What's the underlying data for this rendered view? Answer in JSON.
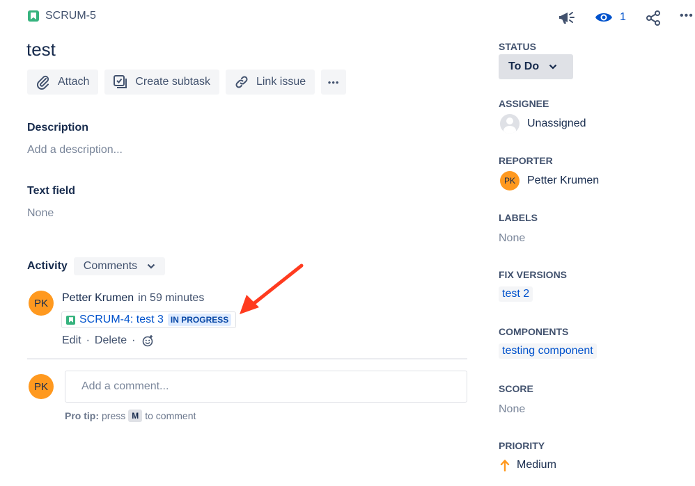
{
  "issue": {
    "key": "SCRUM-5",
    "title": "test"
  },
  "toolbar": {
    "attach_label": "Attach",
    "create_subtask_label": "Create subtask",
    "link_issue_label": "Link issue",
    "more_label": "•••"
  },
  "header_actions": {
    "watchers_count": "1",
    "more_label": "•••"
  },
  "description": {
    "heading": "Description",
    "placeholder": "Add a description..."
  },
  "text_field": {
    "heading": "Text field",
    "value": "None"
  },
  "activity": {
    "heading": "Activity",
    "filter_value": "Comments",
    "comment": {
      "author_initials": "PK",
      "author": "Petter Krumen",
      "time": "in 59 minutes",
      "linked_issue": "SCRUM-4: test 3",
      "linked_status": "IN PROGRESS",
      "edit_label": "Edit",
      "delete_label": "Delete"
    },
    "new_comment": {
      "avatar_initials": "PK",
      "placeholder": "Add a comment...",
      "protip_bold": "Pro tip:",
      "protip_pre": "press",
      "protip_key": "M",
      "protip_post": "to comment"
    }
  },
  "sidebar": {
    "status_label": "STATUS",
    "status_value": "To Do",
    "assignee_label": "ASSIGNEE",
    "assignee_value": "Unassigned",
    "reporter_label": "REPORTER",
    "reporter_initials": "PK",
    "reporter_value": "Petter Krumen",
    "labels_label": "LABELS",
    "labels_value": "None",
    "fix_versions_label": "FIX VERSIONS",
    "fix_versions_value": "test 2",
    "components_label": "COMPONENTS",
    "components_value": "testing component",
    "score_label": "SCORE",
    "score_value": "None",
    "priority_label": "PRIORITY",
    "priority_value": "Medium"
  },
  "colors": {
    "story": "#36b37e",
    "link": "#0052cc",
    "avatar": "#ff991f",
    "annotation_arrow": "#ff3b1f",
    "priority_medium": "#ff991f"
  },
  "icons": [
    "story-icon",
    "paperclip-icon",
    "subtask-icon",
    "link-icon",
    "megaphone-icon",
    "eye-icon",
    "share-icon",
    "chevron-down-icon",
    "emoji-icon",
    "arrow-up-icon"
  ]
}
